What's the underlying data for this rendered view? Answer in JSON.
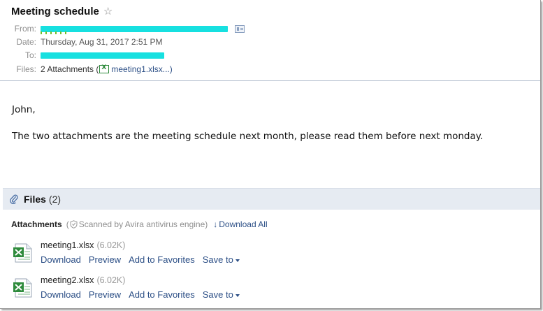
{
  "email": {
    "subject": "Meeting schedule",
    "from_label": "From:",
    "date_label": "Date:",
    "date_value": "Thursday, Aug 31, 2017 2:51 PM",
    "to_label": "To:",
    "files_label": "Files:",
    "files_summary": "2 Attachments (",
    "files_first_name": "meeting1.xlsx...",
    "files_close": ")"
  },
  "body": {
    "greeting": "John,",
    "message": "The two attachments are the meeting schedule next month, please read them before next monday."
  },
  "files_panel": {
    "title": "Files",
    "count": "(2)",
    "attachments_label": "Attachments",
    "scan_open": "(",
    "scan_text": "Scanned by Avira antivirus engine)",
    "download_all": "Download All",
    "items": [
      {
        "name": "meeting1.xlsx",
        "size": "(6.02K)",
        "actions": {
          "download": "Download",
          "preview": "Preview",
          "favorites": "Add to Favorites",
          "save": "Save to"
        }
      },
      {
        "name": "meeting2.xlsx",
        "size": "(6.02K)",
        "actions": {
          "download": "Download",
          "preview": "Preview",
          "favorites": "Add to Favorites",
          "save": "Save to"
        }
      }
    ]
  },
  "icons": {
    "star": "star-icon",
    "contact": "vcard-icon",
    "paperclip": "paperclip-icon",
    "shield": "shield-icon",
    "download": "down-arrow-icon",
    "excel": "excel-file-icon"
  },
  "colors": {
    "link": "#2c4f86",
    "redaction": "#17e0e0",
    "files_bar_bg": "#e6ebf2",
    "excel_green": "#2e8b3c"
  }
}
